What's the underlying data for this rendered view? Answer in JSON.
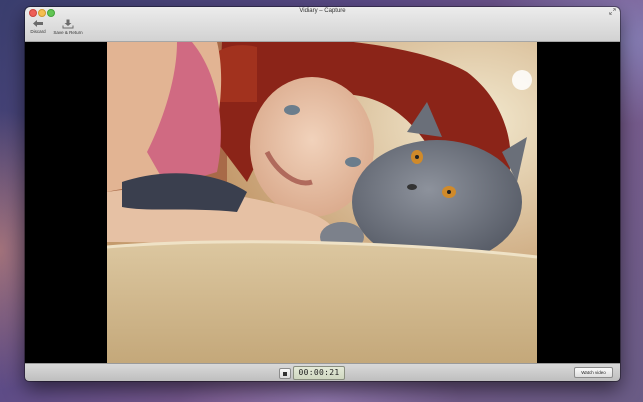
{
  "window": {
    "title": "Vidiary – Capture"
  },
  "toolbar": {
    "discard_label": "Discard",
    "save_label": "Save & Return"
  },
  "preview": {
    "description_icon": "camera-preview"
  },
  "controls": {
    "timer": "00:00:21",
    "watch_label": "Watch video"
  },
  "icons": {
    "discard": "arrow-left-icon",
    "save": "download-icon",
    "stop": "stop-icon",
    "fullscreen": "fullscreen-icon"
  },
  "colors": {
    "close": "#ee5f57",
    "minimize": "#f5be4f",
    "maximize": "#62c554"
  }
}
